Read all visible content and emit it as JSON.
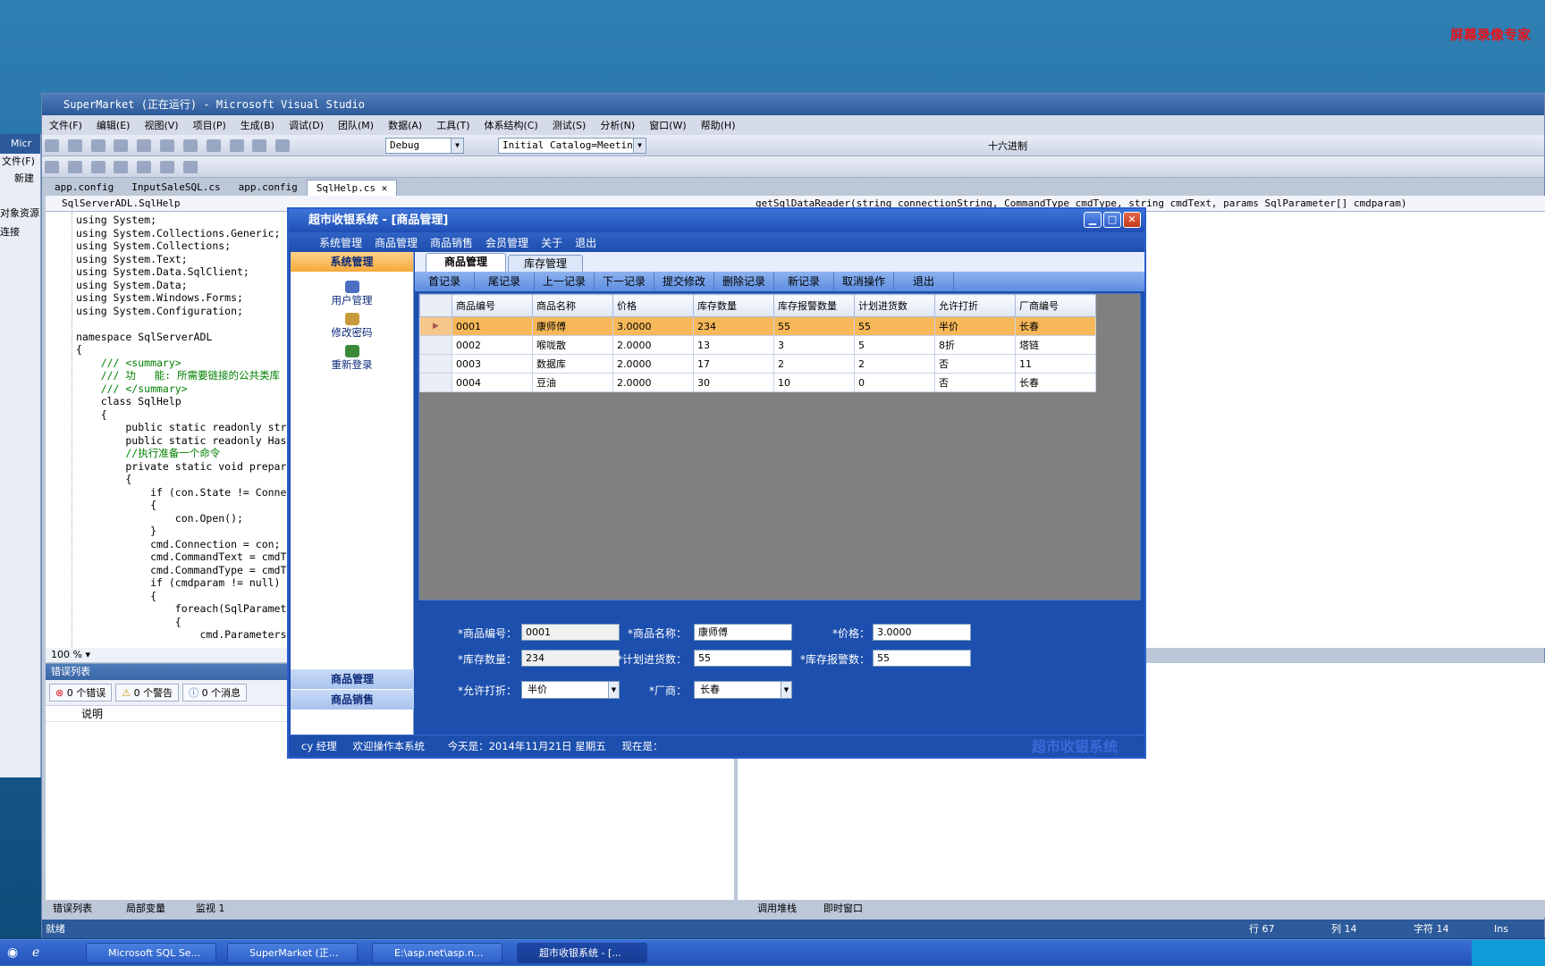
{
  "desktop": {
    "watermark": "屏幕录像专家"
  },
  "vs": {
    "title": "SuperMarket (正在运行) - Microsoft Visual Studio",
    "menu": [
      "文件(F)",
      "编辑(E)",
      "视图(V)",
      "项目(P)",
      "生成(B)",
      "调试(D)",
      "团队(M)",
      "数据(A)",
      "工具(T)",
      "体系结构(C)",
      "测试(S)",
      "分析(N)",
      "窗口(W)",
      "帮助(H)"
    ],
    "config_combo": "Debug",
    "connection_combo": "Initial Catalog=Meeting",
    "hex_label": "十六进制",
    "doc_tabs": [
      "app.config",
      "InputSaleSQL.cs",
      "app.config",
      "SqlHelp.cs"
    ],
    "nav_left": "SqlServerADL.SqlHelp",
    "nav_right": "getSqlDataReader(string connectionString, CommandType cmdType, string cmdText, params SqlParameter[] cmdparam)",
    "code": [
      "using System;",
      "using System.Collections.Generic;",
      "using System.Collections;",
      "using System.Text;",
      "using System.Data.SqlClient;",
      "using System.Data;",
      "using System.Windows.Forms;",
      "using System.Configuration;",
      "",
      "namespace SqlServerADL",
      "{",
      "    /// <summary>",
      "    /// 功   能: 所需要链接的公共类库",
      "    /// </summary>",
      "    class SqlHelp",
      "    {",
      "        public static readonly string",
      "        public static readonly Hashta",
      "        //执行准备一个命令",
      "        private static void prepareCo",
      "        {",
      "            if (con.State != Connecti",
      "            {",
      "                con.Open();",
      "            }",
      "            cmd.Connection = con;",
      "            cmd.CommandText = cmdText",
      "            cmd.CommandType = cmdType",
      "            if (cmdparam != null)",
      "            {",
      "                foreach(SqlParameter p",
      "                {",
      "                    cmd.Parameters.Add"
    ],
    "zoom": "100 %",
    "error_panel": {
      "title": "错误列表",
      "errors": "0 个错误",
      "warnings": "0 个警告",
      "messages": "0 个消息",
      "col_desc": "说明"
    },
    "bottom_tabs_left": [
      "错误列表",
      "局部变量",
      "监视 1"
    ],
    "bottom_tabs_right": [
      "调用堆栈",
      "即时窗口"
    ],
    "status": {
      "ready": "就绪",
      "row": "行 67",
      "col": "列 14",
      "char": "字符 14",
      "ins": "Ins"
    },
    "left_window": {
      "title": "Micr",
      "menu": "文件(F)",
      "new": "新建",
      "res": "对象资源",
      "conn": "连接"
    }
  },
  "app": {
    "title": "超市收银系统 - [商品管理]",
    "menu": [
      "系统管理",
      "商品管理",
      "商品销售",
      "会员管理",
      "关于",
      "退出"
    ],
    "sidebar": {
      "header": "系统管理",
      "items": [
        "用户管理",
        "修改密码",
        "重新登录"
      ],
      "footer": [
        "商品管理",
        "商品销售"
      ]
    },
    "tabs": [
      "商品管理",
      "库存管理"
    ],
    "nav_buttons": [
      "首记录",
      "尾记录",
      "上一记录",
      "下一记录",
      "提交修改",
      "删除记录",
      "新记录",
      "取消操作",
      "退出"
    ],
    "grid": {
      "columns": [
        "商品编号",
        "商品名称",
        "价格",
        "库存数量",
        "库存报警数量",
        "计划进货数",
        "允许打折",
        "厂商编号"
      ],
      "rows": [
        [
          "0001",
          "康师傅",
          "3.0000",
          "234",
          "55",
          "55",
          "半价",
          "长春"
        ],
        [
          "0002",
          "喉咙散",
          "2.0000",
          "13",
          "3",
          "5",
          "8折",
          "塔链"
        ],
        [
          "0003",
          "数据库",
          "2.0000",
          "17",
          "2",
          "2",
          "否",
          "11"
        ],
        [
          "0004",
          "豆油",
          "2.0000",
          "30",
          "10",
          "0",
          "否",
          "长春"
        ]
      ]
    },
    "form": {
      "code_label": "*商品编号：",
      "code_value": "0001",
      "name_label": "*商品名称：",
      "name_value": "康师傅",
      "price_label": "*价格：",
      "price_value": "3.0000",
      "stock_label": "*库存数量：",
      "stock_value": "234",
      "plan_label": "*计划进货数：",
      "plan_value": "55",
      "alarm_label": "*库存报警数：",
      "alarm_value": "55",
      "discount_label": "*允许打折：",
      "discount_value": "半价",
      "vendor_label": "*厂商：",
      "vendor_value": "长春"
    },
    "status": {
      "user": "cy 经理",
      "welcome": "欢迎操作本系统",
      "date": "今天是：2014年11月21日 星期五",
      "now_label": "现在是：",
      "brand": "超市收银系统"
    }
  },
  "taskbar": {
    "tasks": [
      "Microsoft SQL Se...",
      "SuperMarket (正...",
      "E:\\asp.net\\asp.n...",
      "超市收银系统 - [..."
    ]
  }
}
